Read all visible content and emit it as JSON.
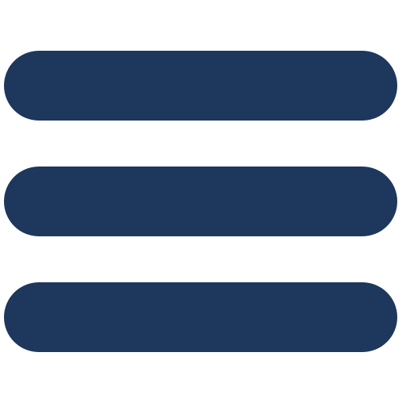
{
  "icon": {
    "name": "hamburger-menu-icon",
    "bar_color": "#1e375c",
    "background_color": "#ffffff",
    "bars": 3
  }
}
